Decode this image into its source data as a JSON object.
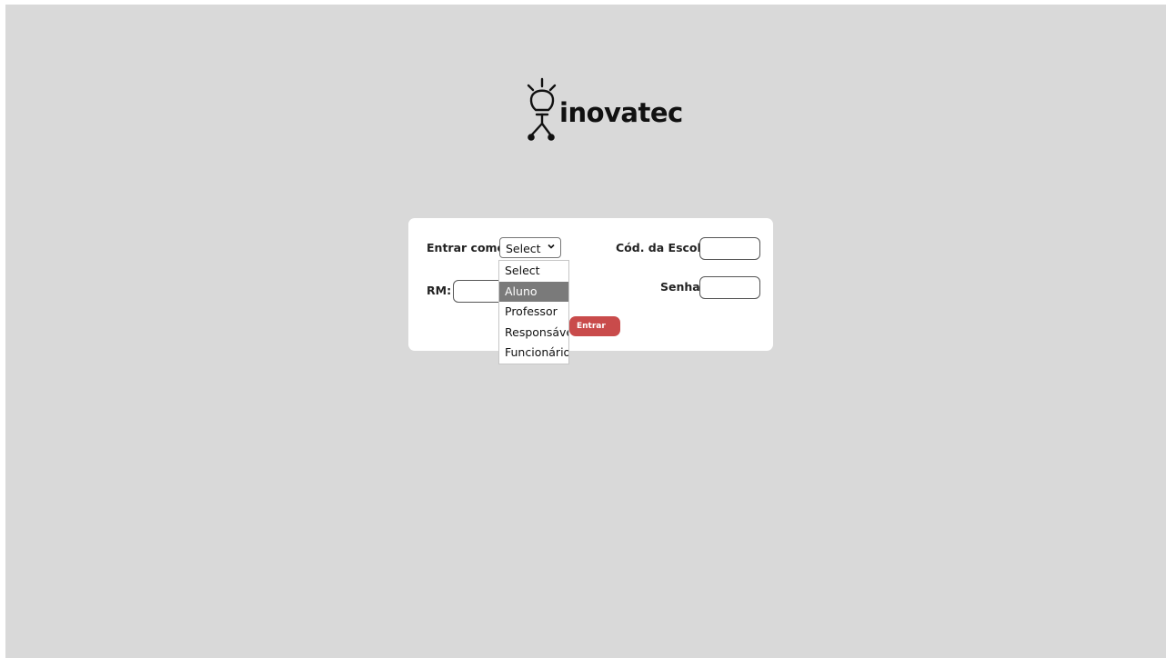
{
  "brand": {
    "name": "inovatec",
    "logo_icon": "lightbulb-icon"
  },
  "form": {
    "role_label": "Entrar como:",
    "role_selected": "Select",
    "role_options": [
      "Select",
      "Aluno",
      "Professor",
      "Responsável",
      "Funcionário"
    ],
    "role_highlighted": "Aluno",
    "school_code_label": "Cód. da Escola:",
    "school_code_value": "",
    "rm_label": "RM:",
    "rm_value": "",
    "password_label": "Senha:",
    "password_value": "",
    "submit_label": "Entrar"
  },
  "colors": {
    "background": "#d9d9d9",
    "card": "#ffffff",
    "button": "#c94b4b",
    "option_highlight": "#7a7a7a"
  }
}
